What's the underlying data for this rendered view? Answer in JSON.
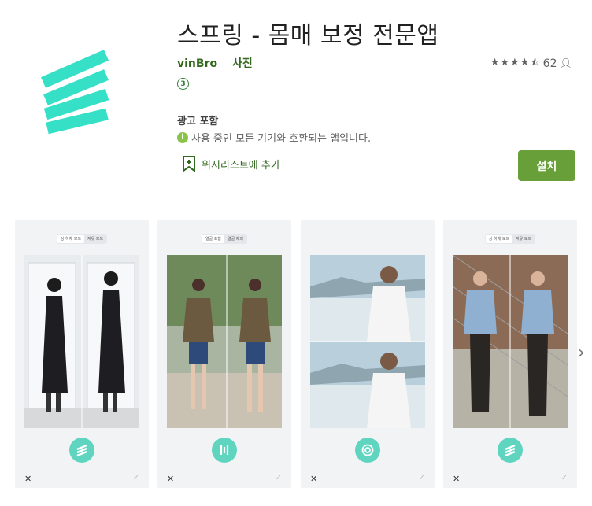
{
  "app": {
    "title": "스프링 - 몸매 보정 전문앱",
    "developer": "vinBro",
    "category": "사진",
    "rating_count": "62",
    "content_rating": "3",
    "ads_label": "광고 포함",
    "compat_text": "사용 중인 모든 기기와 호환되는 앱입니다.",
    "wishlist_label": "위시리스트에 추가",
    "install_label": "설치",
    "stars": 4.5
  },
  "colors": {
    "accent_green": "#689f38",
    "dev_green": "#33691e",
    "brand_teal": "#36e0c6",
    "fab_teal": "#5fd5c0"
  },
  "screenshots": [
    {
      "tab1": "상 하체 모드",
      "tab2": "자유 모드",
      "icon": "spring-icon"
    },
    {
      "tab1": "얼굴 포함",
      "tab2": "얼굴 제외",
      "icon": "sliders-icon"
    },
    {
      "tab1": "",
      "tab2": "",
      "icon": "target-icon"
    },
    {
      "tab1": "상 하체 모드",
      "tab2": "자유 모드",
      "icon": "spring-icon"
    }
  ]
}
